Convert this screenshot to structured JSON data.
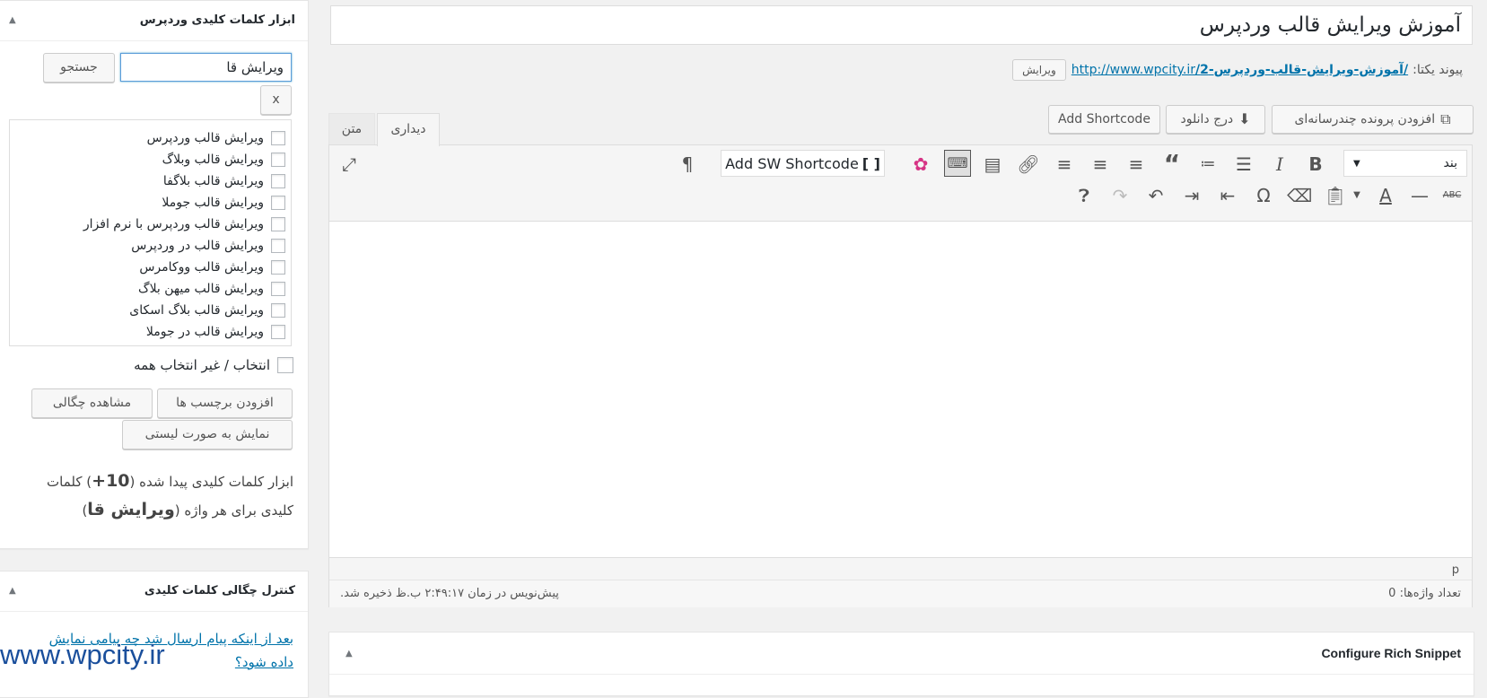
{
  "sidebar": {
    "keywords_box": {
      "title": "ابزار کلمات کلیدی وردپرس",
      "search_value": "ویرایش قا",
      "search_button": "جستجو",
      "clear_button": "x",
      "items": [
        "ویرایش قالب وردپرس",
        "ویرایش قالب وبلاگ",
        "ویرایش قالب بلاگفا",
        "ویرایش قالب جوملا",
        "ویرایش قالب وردپرس با نرم افزار",
        "ویرایش قالب در وردپرس",
        "ویرایش قالب ووکامرس",
        "ویرایش قالب میهن بلاگ",
        "ویرایش قالب بلاگ اسکای",
        "ویرایش قالب در جوملا"
      ],
      "select_all": "انتخاب / غیر انتخاب همه",
      "add_tags_button": "افزودن برچسب ها",
      "view_density_button": "مشاهده چگالی",
      "list_view_button": "نمایش به صورت لیستی",
      "result_text_1": "ابزار کلمات کلیدی پیدا شده (",
      "result_count": "10+",
      "result_text_2": ") کلمات",
      "result_text_3": "کلیدی برای هر واژه (",
      "result_term": "ویرایش قا",
      "result_text_4": ")"
    },
    "density_box": {
      "title": "کنترل چگالی کلمات کلیدی",
      "link_text": "بعد از اینکه پیام ارسال شد چه پیامی نمایش داده شود؟"
    }
  },
  "watermark": "www.wpcity.ir",
  "editor": {
    "title": "آموزش ویرایش قالب وردپرس",
    "permalink_label": "پیوند یکتا:",
    "permalink_base": "http://www.wpcity.ir",
    "permalink_slug": "/آموزش-ویرایش-قالب-وردپرس-2/",
    "permalink_edit": "ویرایش",
    "add_media_button": "افزودن پرونده چندرسانه‌ای",
    "insert_download_button": "درج دانلود",
    "add_shortcode_button": "Add Shortcode",
    "tab_visual": "دیداری",
    "tab_text": "متن",
    "format_select": "بند",
    "sw_shortcode_button": "Add SW Shortcode",
    "path": "p",
    "word_count": "تعداد واژه‌ها: 0",
    "draft_status": "پیش‌نویس در زمان ۲:۴۹:۱۷ ب.ظ ذخیره شد."
  },
  "rich_snippet": {
    "title": "Configure Rich Snippet"
  }
}
